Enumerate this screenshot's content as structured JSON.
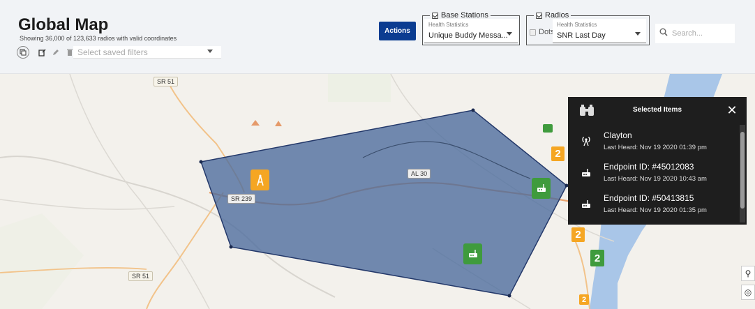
{
  "header": {
    "title": "Global Map",
    "subtitle": "Showing 36,000 of 123,633 radios with valid coordinates",
    "filter_placeholder": "Select saved filters",
    "actions_label": "Actions",
    "base_stations": {
      "label": "Base Stations",
      "checked": true,
      "health_label": "Health Statistics",
      "health_value": "Unique Buddy Messa..."
    },
    "radios": {
      "label": "Radios",
      "checked": true,
      "dots_label": "Dots",
      "dots_checked": false,
      "health_label": "Health Statistics",
      "health_value": "SNR Last Day"
    },
    "search_placeholder": "Search..."
  },
  "map": {
    "road_labels": [
      "SR 51",
      "SR 239",
      "AL 30",
      "SR 51"
    ],
    "cluster_counts": [
      "2",
      "2",
      "2",
      "2"
    ],
    "polygon_color": "#4a6a9c"
  },
  "panel": {
    "title": "Selected Items",
    "items": [
      {
        "name": "Clayton",
        "sub": "Last Heard: Nov 19 2020 01:39 pm",
        "icon": "antenna-icon"
      },
      {
        "name": "Endpoint ID: #45012083",
        "sub": "Last Heard: Nov 19 2020 10:43 am",
        "icon": "radio-icon"
      },
      {
        "name": "Endpoint ID: #50413815",
        "sub": "Last Heard: Nov 19 2020 01:35 pm",
        "icon": "radio-icon"
      }
    ]
  },
  "colors": {
    "accent": "#0b3c91",
    "marker_green": "#3f9b3d",
    "marker_orange": "#f5a623",
    "panel_bg": "#1e1e1e"
  }
}
